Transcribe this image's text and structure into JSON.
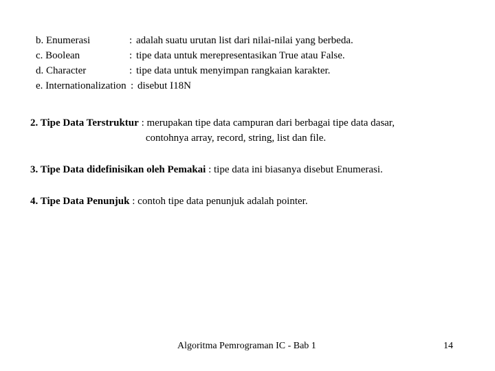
{
  "slide": {
    "definition_list": [
      {
        "term": "b. Enumerasi",
        "colon": ":",
        "description": "adalah suatu urutan list dari nilai-nilai yang berbeda."
      },
      {
        "term": "c. Boolean",
        "colon": ":",
        "description": "tipe data untuk merepresentasikan True atau False."
      },
      {
        "term": "d. Character",
        "colon": ":",
        "description": "tipe data untuk menyimpan rangkaian karakter."
      },
      {
        "term": "e. Internationalization",
        "colon": ":",
        "description": "disebut I18N"
      }
    ],
    "entries": [
      {
        "lead": "2. Tipe Data Terstruktur",
        "body": " : merupakan tipe data campuran dari berbagai tipe data dasar,",
        "continuation": "contohnya array, record, string, list dan file."
      },
      {
        "lead": "3. Tipe Data didefinisikan oleh Pemakai",
        "body": " : tipe data ini biasanya disebut Enumerasi.",
        "continuation": ""
      },
      {
        "lead": "4. Tipe Data Penunjuk",
        "body": " : contoh tipe data penunjuk adalah pointer.",
        "continuation": ""
      }
    ],
    "footer": {
      "title": "Algoritma Pemrograman IC - Bab 1",
      "page_number": "14"
    }
  }
}
